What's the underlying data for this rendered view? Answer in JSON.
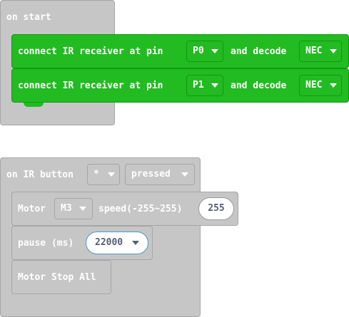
{
  "on_start": {
    "label": "on start",
    "blocks": [
      {
        "prefix": "connect IR receiver at pin",
        "pin": "P0",
        "mid": "and decode",
        "decoder": "NEC"
      },
      {
        "prefix": "connect IR receiver at pin",
        "pin": "P1",
        "mid": "and decode",
        "decoder": "NEC"
      }
    ]
  },
  "on_ir_button": {
    "label": "on IR button",
    "button": "*",
    "action": "pressed",
    "motor": {
      "label": "Motor",
      "motor_id": "M3",
      "speed_label": "speed(-255~255)",
      "speed_value": "255"
    },
    "pause": {
      "label": "pause (ms)",
      "value": "22000"
    },
    "stop": {
      "label": "Motor Stop All"
    }
  },
  "colors": {
    "ir_block": "#22bb22",
    "event_block": "#c6c6c6"
  },
  "icons": [
    "dropdown-caret-icon"
  ]
}
